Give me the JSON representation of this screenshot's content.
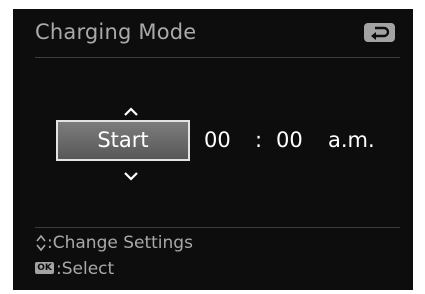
{
  "header": {
    "title": "Charging Mode",
    "back_icon": "return-arrow-icon"
  },
  "selector": {
    "start_label": "Start",
    "up_icon": "caret-up-icon",
    "down_icon": "caret-down-icon"
  },
  "time": {
    "hours": "00",
    "separator": ":",
    "minutes": "00",
    "ampm": "a.m."
  },
  "help": {
    "change_icon": "up-down-icon",
    "change_label": ":Change Settings",
    "ok_icon_text": "OK",
    "select_label": ":Select"
  },
  "colors": {
    "background": "#0d0d0d",
    "text_gray": "#a9a9a9",
    "text_white": "#ffffff",
    "button_border": "#e3e3e3"
  }
}
